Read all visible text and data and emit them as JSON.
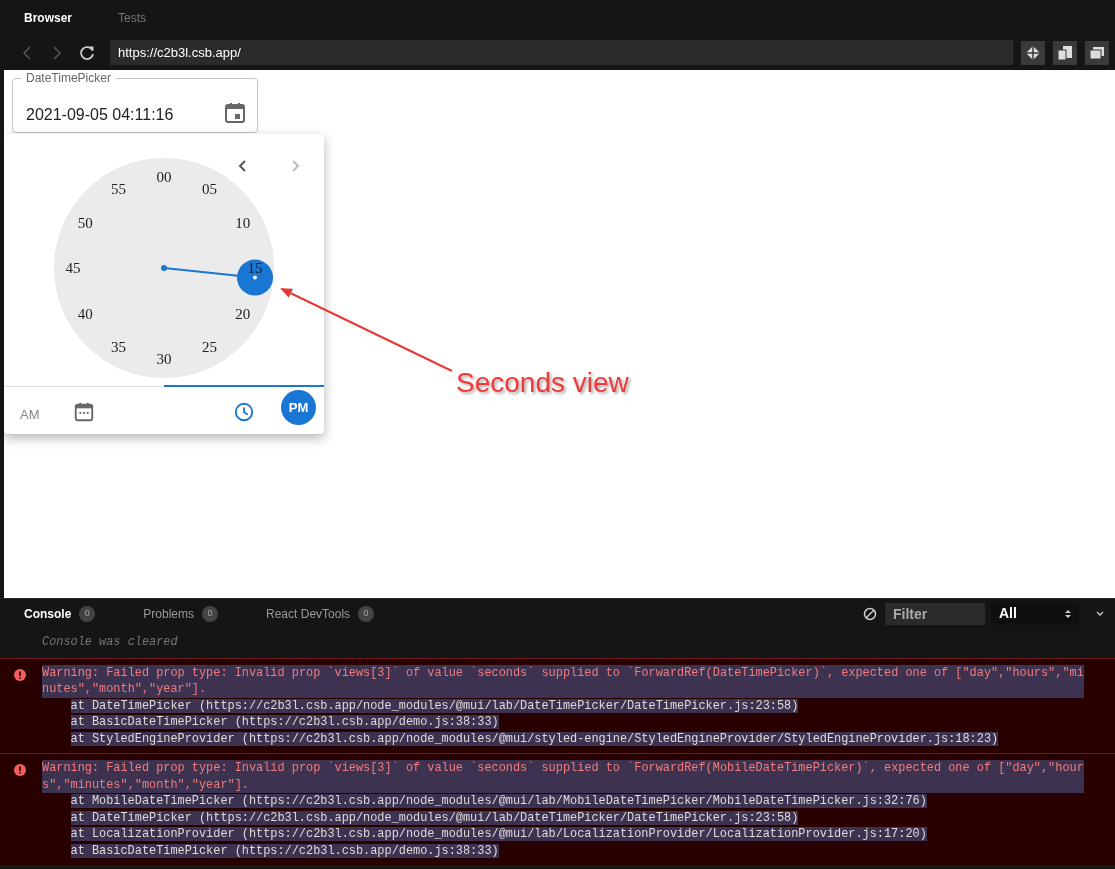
{
  "tabs": [
    {
      "label": "Browser",
      "selected": true
    },
    {
      "label": "Tests",
      "selected": false
    }
  ],
  "address_bar": {
    "url": "https://c2b3l.csb.app/"
  },
  "date_time_field": {
    "label": "DateTimePicker",
    "value": "2021-09-05 04:11:16"
  },
  "picker": {
    "prev_disabled": false,
    "next_disabled": true,
    "clock_labels": [
      {
        "label": "00",
        "selected": false
      },
      {
        "label": "05",
        "selected": false
      },
      {
        "label": "10",
        "selected": false
      },
      {
        "label": "15",
        "selected": true
      },
      {
        "label": "20",
        "selected": false
      },
      {
        "label": "25",
        "selected": false
      },
      {
        "label": "30",
        "selected": false
      },
      {
        "label": "35",
        "selected": false
      },
      {
        "label": "40",
        "selected": false
      },
      {
        "label": "45",
        "selected": false
      },
      {
        "label": "50",
        "selected": false
      },
      {
        "label": "55",
        "selected": false
      }
    ],
    "view_tabs": [
      {
        "kind": "date",
        "selected": false
      },
      {
        "kind": "time",
        "selected": true
      }
    ],
    "meridiem": [
      {
        "label": "AM",
        "selected": false
      },
      {
        "label": "PM",
        "selected": true
      }
    ]
  },
  "annotation": {
    "text": "Seconds view"
  },
  "console": {
    "tabs": [
      {
        "label": "Console",
        "count": "0",
        "selected": true
      },
      {
        "label": "Problems",
        "count": "0",
        "selected": false
      },
      {
        "label": "React DevTools",
        "count": "0",
        "selected": false
      }
    ],
    "filter": {
      "placeholder": "Filter"
    },
    "level_select": "All",
    "cleared_message": "Console was cleared",
    "entries": [
      {
        "message": "Warning: Failed prop type: Invalid prop `views[3]` of value `seconds` supplied to `ForwardRef(DateTimePicker)`, expected one of [\"day\",\"hours\",\"minutes\",\"month\",\"year\"].",
        "stack": [
          "at DateTimePicker (https://c2b3l.csb.app/node_modules/@mui/lab/DateTimePicker/DateTimePicker.js:23:58)",
          "at BasicDateTimePicker (https://c2b3l.csb.app/demo.js:38:33)",
          "at StyledEngineProvider (https://c2b3l.csb.app/node_modules/@mui/styled-engine/StyledEngineProvider/StyledEngineProvider.js:18:23)"
        ]
      },
      {
        "message": "Warning: Failed prop type: Invalid prop `views[3]` of value `seconds` supplied to `ForwardRef(MobileDateTimePicker)`, expected one of [\"day\",\"hours\",\"minutes\",\"month\",\"year\"].",
        "stack": [
          "at MobileDateTimePicker (https://c2b3l.csb.app/node_modules/@mui/lab/MobileDateTimePicker/MobileDateTimePicker.js:32:76)",
          "at DateTimePicker (https://c2b3l.csb.app/node_modules/@mui/lab/DateTimePicker/DateTimePicker.js:23:58)",
          "at LocalizationProvider (https://c2b3l.csb.app/node_modules/@mui/lab/LocalizationProvider/LocalizationProvider.js:17:20)",
          "at BasicDateTimePicker (https://c2b3l.csb.app/demo.js:38:33)"
        ]
      }
    ]
  }
}
